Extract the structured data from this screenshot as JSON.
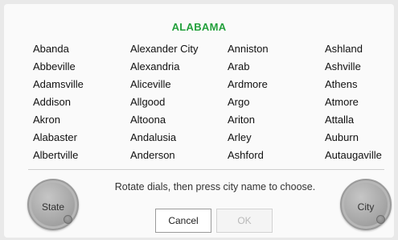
{
  "title": "ALABAMA",
  "title_color": "#23a03c",
  "cities": [
    "Abanda",
    "Abbeville",
    "Adamsville",
    "Addison",
    "Akron",
    "Alabaster",
    "Albertville",
    "Alexander City",
    "Alexandria",
    "Aliceville",
    "Allgood",
    "Altoona",
    "Andalusia",
    "Anderson",
    "Anniston",
    "Arab",
    "Ardmore",
    "Argo",
    "Ariton",
    "Arley",
    "Ashford",
    "Ashland",
    "Ashville",
    "Athens",
    "Atmore",
    "Attalla",
    "Auburn",
    "Autaugaville"
  ],
  "instruction": "Rotate dials, then press city name to choose.",
  "buttons": {
    "cancel": "Cancel",
    "ok": "OK"
  },
  "dials": {
    "state_label": "State",
    "city_label": "City"
  }
}
